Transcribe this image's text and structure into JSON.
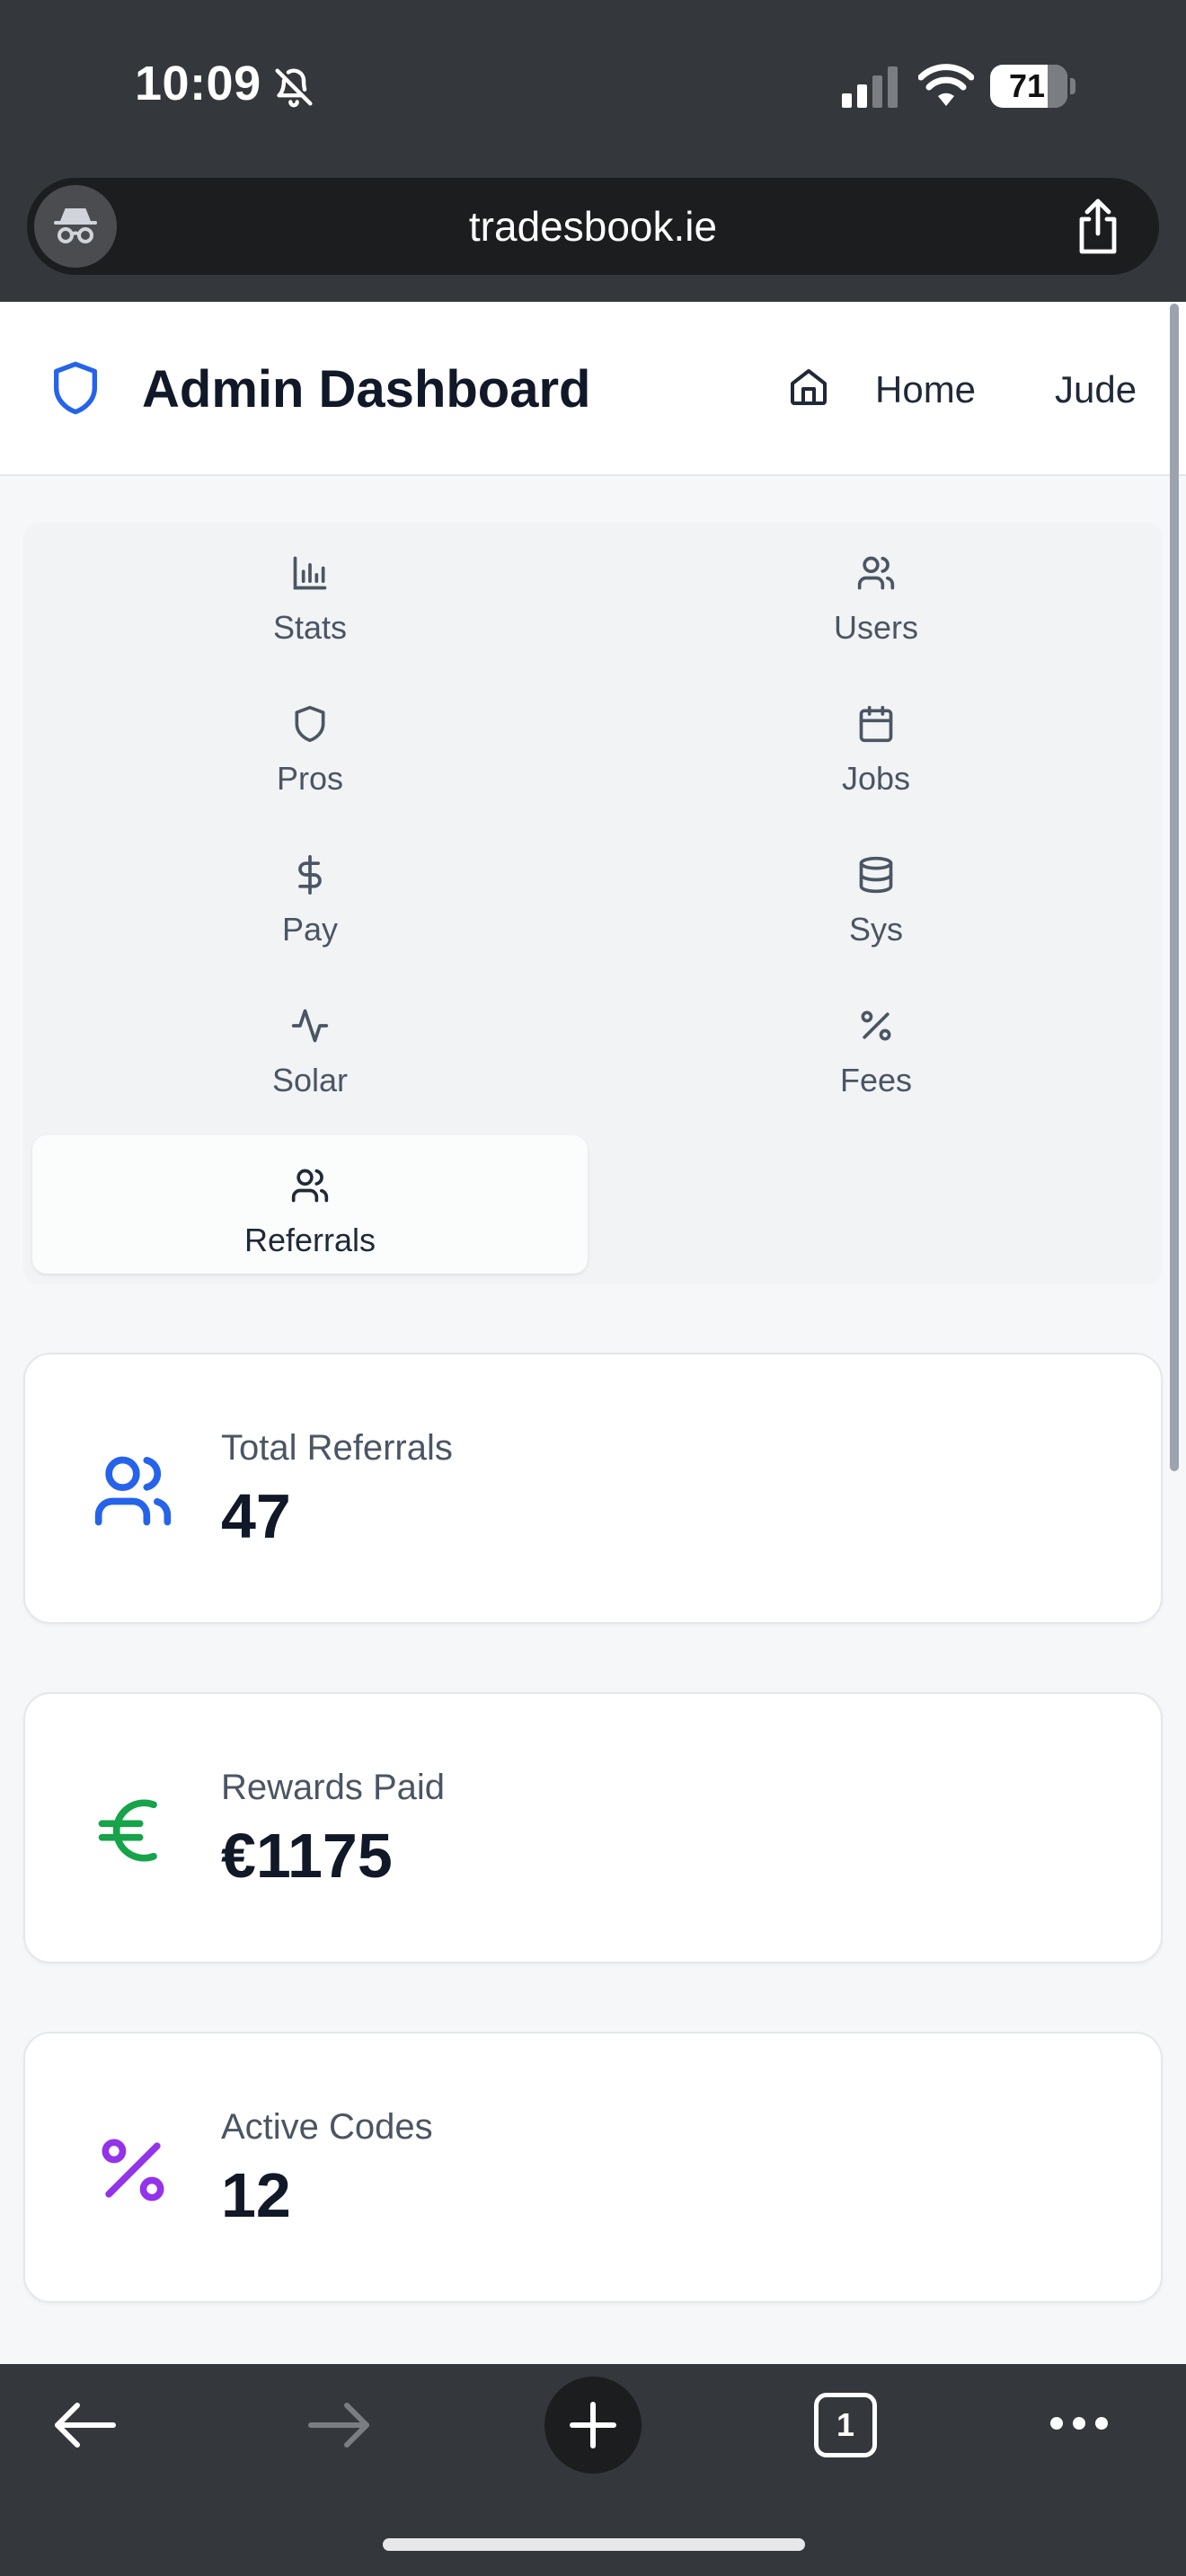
{
  "status_bar": {
    "time": "10:09",
    "battery": "71"
  },
  "browser": {
    "url": "tradesbook.ie",
    "open_tabs": "1"
  },
  "header": {
    "title": "Admin Dashboard",
    "home_label": "Home",
    "user_name": "Jude"
  },
  "nav": {
    "items": [
      {
        "label": "Stats",
        "icon": "bar-chart-icon"
      },
      {
        "label": "Users",
        "icon": "users-icon"
      },
      {
        "label": "Pros",
        "icon": "shield-icon"
      },
      {
        "label": "Jobs",
        "icon": "calendar-icon"
      },
      {
        "label": "Pay",
        "icon": "dollar-icon"
      },
      {
        "label": "Sys",
        "icon": "database-icon"
      },
      {
        "label": "Solar",
        "icon": "activity-icon"
      },
      {
        "label": "Fees",
        "icon": "percent-icon"
      },
      {
        "label": "Referrals",
        "icon": "users-icon",
        "active": true
      }
    ]
  },
  "stats": [
    {
      "label": "Total Referrals",
      "value": "47",
      "icon": "users-icon",
      "color": "#2563eb"
    },
    {
      "label": "Rewards Paid",
      "value": "€1175",
      "icon": "euro-icon",
      "color": "#16a34a"
    },
    {
      "label": "Active Codes",
      "value": "12",
      "icon": "percent-icon",
      "color": "#9333ea"
    }
  ],
  "colors": {
    "accent": "#2563eb",
    "chrome": "#34373b"
  }
}
